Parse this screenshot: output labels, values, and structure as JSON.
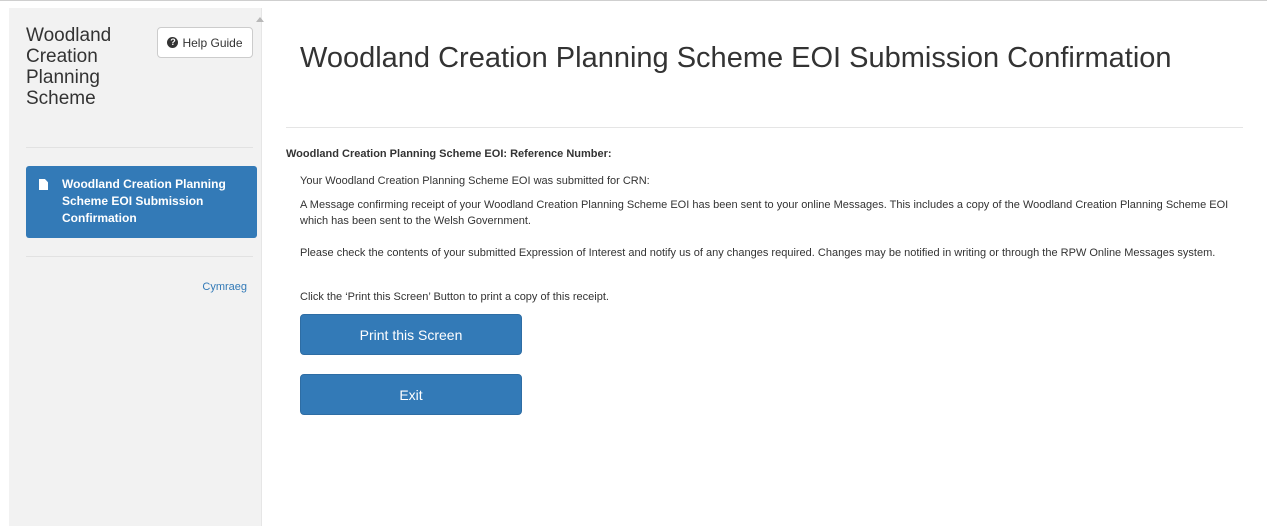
{
  "sidebar": {
    "title": "Woodland Creation Planning Scheme",
    "help_button_label": "Help Guide",
    "help_icon": "question-circle-icon",
    "active_item_label": "Woodland Creation Planning Scheme EOI Submission Confirmation",
    "active_item_icon": "document-icon",
    "language_link": "Cymraeg"
  },
  "main": {
    "title": "Woodland Creation Planning Scheme EOI Submission Confirmation",
    "reference_heading": "Woodland Creation Planning Scheme EOI: Reference Number:",
    "paragraphs": [
      "Your Woodland Creation Planning Scheme EOI was submitted for CRN:",
      "A Message confirming receipt of your Woodland Creation Planning Scheme EOI has been sent to your online Messages. This includes a copy of the Woodland Creation Planning Scheme EOI which has been sent to the Welsh Government.",
      "Please check the contents of your submitted Expression of Interest and notify us of any changes required. Changes may be notified in writing or through the RPW Online Messages system.",
      "Click the ‘Print this Screen’ Button to print a copy of this receipt."
    ],
    "print_button_label": "Print this Screen",
    "exit_button_label": "Exit"
  },
  "colors": {
    "primary": "#337ab7",
    "sidebar_bg": "#f2f2f2"
  }
}
